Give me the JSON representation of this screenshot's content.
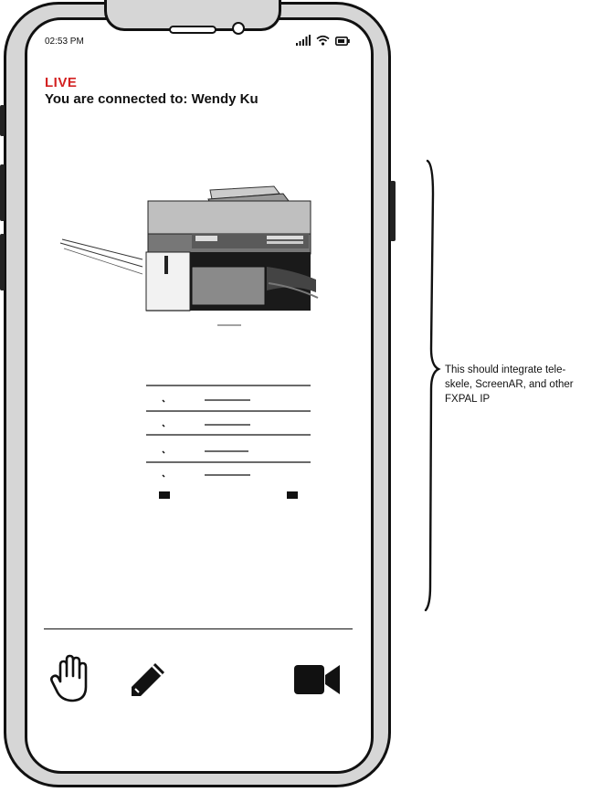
{
  "status_bar": {
    "time": "02:53 PM",
    "icons": [
      "signal-icon",
      "wifi-icon",
      "battery-icon"
    ]
  },
  "header": {
    "live_label": "LIVE",
    "connection_text": "You are connected to: Wendy Ku"
  },
  "colors": {
    "live": "#d32222",
    "text": "#111111",
    "device_frame": "#d6d6d6"
  },
  "toolbar": {
    "tools": [
      "hand-icon",
      "pencil-icon",
      "video-camera-icon"
    ]
  },
  "annotation": {
    "note": "This should integrate tele-skele, ScreenAR, and other FXPAL IP"
  }
}
